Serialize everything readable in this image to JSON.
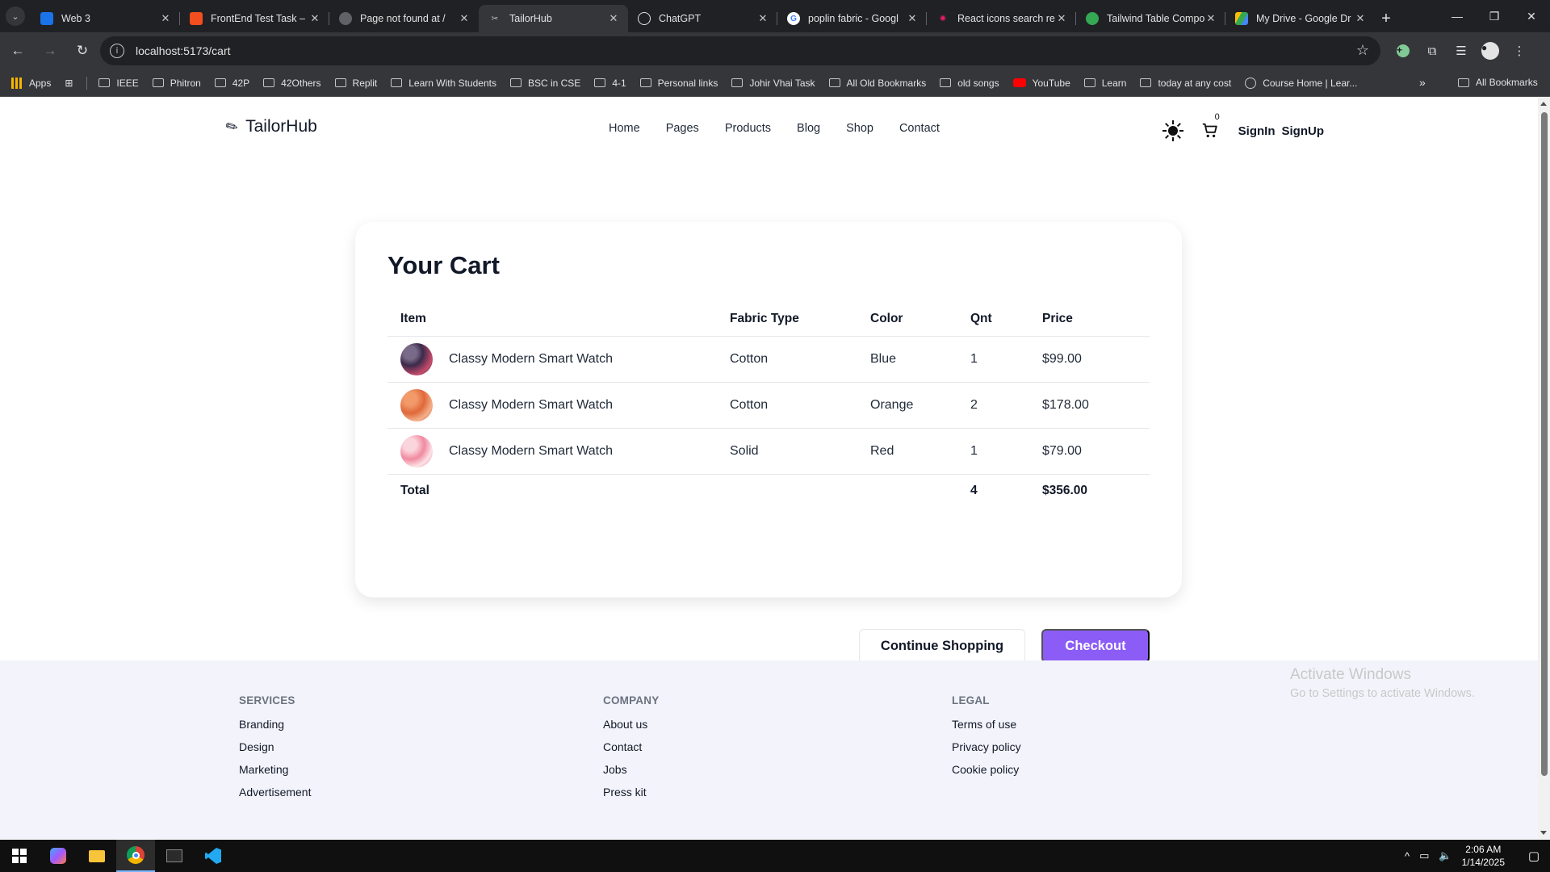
{
  "browser": {
    "tabs": [
      {
        "title": "Web 3",
        "favicon_color": "#1a73e8",
        "icon": "web3-favicon"
      },
      {
        "title": "FrontEnd Test Task – F",
        "favicon_color": "#f24e1e",
        "icon": "figma-favicon"
      },
      {
        "title": "Page not found at /",
        "favicon_color": "#5f6368",
        "icon": "globe-favicon"
      },
      {
        "title": "TailorHub",
        "favicon_color": "#9aa0a6",
        "icon": "tailorhub-favicon",
        "active": true
      },
      {
        "title": "ChatGPT",
        "favicon_color": "#e3e3e3",
        "icon": "chatgpt-favicon"
      },
      {
        "title": "poplin fabric - Googl",
        "favicon_color": "#4285f4",
        "icon": "google-favicon"
      },
      {
        "title": "React icons search re",
        "favicon_color": "#e91e63",
        "icon": "react-icons-favicon"
      },
      {
        "title": "Tailwind Table Compo",
        "favicon_color": "#34a853",
        "icon": "tailwind-favicon"
      },
      {
        "title": "My Drive - Google Dr",
        "favicon_color": "#fbbc04",
        "icon": "drive-favicon"
      }
    ],
    "url": "localhost:5173/cart",
    "bookmarks": [
      "Apps",
      "IEEE",
      "Phitron",
      "42P",
      "42Others",
      "Replit",
      "Learn With Students",
      "BSC in CSE",
      "4-1",
      "Personal links",
      "Johir Vhai Task",
      "All Old Bookmarks",
      "old songs",
      "YouTube",
      "Learn",
      "today at any cost",
      "Course Home | Lear..."
    ],
    "all_bookmarks": "All Bookmarks"
  },
  "site": {
    "logo": "TailorHub",
    "nav": [
      "Home",
      "Pages",
      "Products",
      "Blog",
      "Shop",
      "Contact"
    ],
    "cart_count": "0",
    "signin": "SignIn",
    "signup": "SignUp"
  },
  "cart": {
    "title": "Your Cart",
    "headers": {
      "item": "Item",
      "fabric": "Fabric Type",
      "color": "Color",
      "qnt": "Qnt",
      "price": "Price"
    },
    "rows": [
      {
        "name": "Classy Modern Smart Watch",
        "fabric": "Cotton",
        "color": "Blue",
        "qnt": "1",
        "price": "$99.00"
      },
      {
        "name": "Classy Modern Smart Watch",
        "fabric": "Cotton",
        "color": "Orange",
        "qnt": "2",
        "price": "$178.00"
      },
      {
        "name": "Classy Modern Smart Watch",
        "fabric": "Solid",
        "color": "Red",
        "qnt": "1",
        "price": "$79.00"
      }
    ],
    "total": {
      "label": "Total",
      "qnt": "4",
      "price": "$356.00"
    },
    "continue_label": "Continue Shopping",
    "checkout_label": "Checkout",
    "accent": "#8b5cf6"
  },
  "footer": {
    "services": {
      "title": "SERVICES",
      "links": [
        "Branding",
        "Design",
        "Marketing",
        "Advertisement"
      ]
    },
    "company": {
      "title": "COMPANY",
      "links": [
        "About us",
        "Contact",
        "Jobs",
        "Press kit"
      ]
    },
    "legal": {
      "title": "LEGAL",
      "links": [
        "Terms of use",
        "Privacy policy",
        "Cookie policy"
      ]
    }
  },
  "watermark": {
    "line1": "Activate Windows",
    "line2": "Go to Settings to activate Windows."
  },
  "taskbar": {
    "time": "2:06 AM",
    "date": "1/14/2025"
  }
}
